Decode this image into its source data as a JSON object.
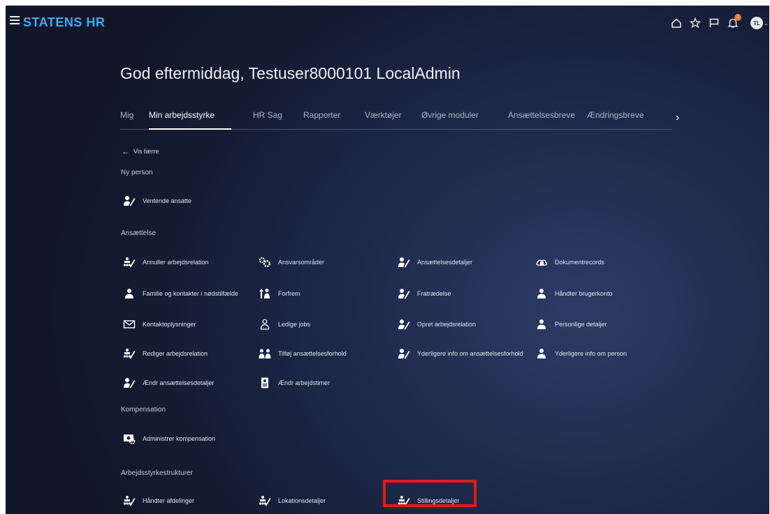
{
  "header": {
    "brand": "STATENS HR",
    "avatar_initials": "TL",
    "notification_count": "1",
    "accent_color": "#3fa9f5"
  },
  "greeting": "God eftermiddag, Testuser8000101 LocalAdmin",
  "tabs": [
    "Mig",
    "Min arbejdsstyrke",
    "HR Sag",
    "Rapporter",
    "Værktøjer",
    "Øvrige moduler",
    "Ansættelsesbreve",
    "Ændringsbreve"
  ],
  "active_tab": "Min arbejdsstyrke",
  "back_link": "Vis færre",
  "sections": {
    "ny_person": {
      "title": "Ny person",
      "items": [
        {
          "label": "Ventende ansatte",
          "icon": "person-edit-icon"
        }
      ]
    },
    "ansaettelse": {
      "title": "Ansættelse",
      "items": [
        {
          "label": "Annuller arbejdsrelation",
          "icon": "org-edit-icon"
        },
        {
          "label": "Ansvarsområder",
          "icon": "gears-icon"
        },
        {
          "label": "Ansættelsesdetaljer",
          "icon": "person-edit-icon"
        },
        {
          "label": "Dokumentrecords",
          "icon": "document-cloud-icon"
        },
        {
          "label": "Familie og kontakter i nødstilfælde",
          "icon": "person-icon"
        },
        {
          "label": "Forfrem",
          "icon": "promote-icon"
        },
        {
          "label": "Fratrædelse",
          "icon": "person-edit-icon"
        },
        {
          "label": "Håndter brugerkonto",
          "icon": "person-icon"
        },
        {
          "label": "Kontaktoplysninger",
          "icon": "envelope-icon"
        },
        {
          "label": "Ledige jobs",
          "icon": "person-outline-icon"
        },
        {
          "label": "Opret arbejdsrelation",
          "icon": "person-edit-icon"
        },
        {
          "label": "Personlige detaljer",
          "icon": "person-icon"
        },
        {
          "label": "Rediger arbejdsrelation",
          "icon": "org-edit-icon"
        },
        {
          "label": "Tilføj ansættelsesforhold",
          "icon": "people-add-icon"
        },
        {
          "label": "Yderligere info om ansættelsesforhold",
          "icon": "person-edit-icon"
        },
        {
          "label": "Yderligere info om person",
          "icon": "person-icon"
        },
        {
          "label": "Ændr ansættelsesdetaljer",
          "icon": "person-edit-icon"
        },
        {
          "label": "Ændr arbejdstimer",
          "icon": "badge-clock-icon"
        }
      ]
    },
    "kompensation": {
      "title": "Kompensation",
      "items": [
        {
          "label": "Administrer kompensation",
          "icon": "money-gear-icon"
        }
      ]
    },
    "arbejdsstyrkestrukturer": {
      "title": "Arbejdsstyrkestrukturer",
      "items": [
        {
          "label": "Håndter afdelinger",
          "icon": "org-edit-icon"
        },
        {
          "label": "Lokationsdetaljer",
          "icon": "org-edit-icon"
        },
        {
          "label": "Stillingsdetaljer",
          "icon": "org-edit-icon"
        }
      ]
    }
  },
  "highlight_color": "#e01b1b"
}
